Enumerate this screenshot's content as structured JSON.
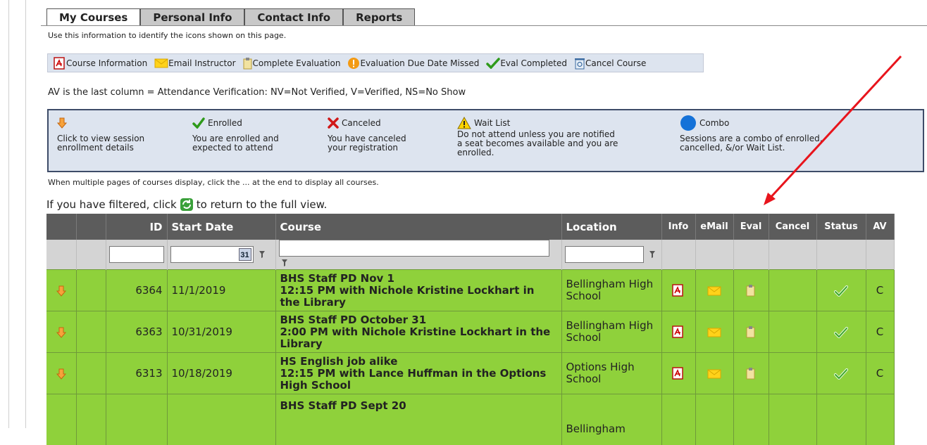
{
  "tabs": [
    {
      "label": "My Courses",
      "active": true
    },
    {
      "label": "Personal Info",
      "active": false
    },
    {
      "label": "Contact Info",
      "active": false
    },
    {
      "label": "Reports",
      "active": false
    }
  ],
  "icon_hint": "Use this information to identify the icons shown on this page.",
  "icon_legend": {
    "course_info": "Course Information",
    "email": "Email Instructor",
    "complete_eval": "Complete Evaluation",
    "due_missed": "Evaluation Due Date Missed",
    "eval_completed": "Eval Completed",
    "cancel": "Cancel Course"
  },
  "av_note": "AV is the last column = Attendance Verification: NV=Not Verified, V=Verified, NS=No Show",
  "status_legend": {
    "session_desc": "Click to view session enrollment details",
    "enrolled_title": "Enrolled",
    "enrolled_desc": "You are enrolled and expected to attend",
    "canceled_title": "Canceled",
    "canceled_desc": "You have canceled your registration",
    "waitlist_title": "Wait List",
    "waitlist_desc": "Do not attend unless you are notified a seat becomes available and you are enrolled.",
    "combo_title": "Combo",
    "combo_desc": "Sessions are a combo of enrolled, cancelled, &/or Wait List."
  },
  "multi_note": "When multiple pages of courses display, click the ... at the end to display all courses.",
  "filter_note": {
    "before": "If you have filtered, click",
    "after": "to return to the full view."
  },
  "columns": {
    "id": "ID",
    "start_date": "Start Date",
    "course": "Course",
    "location": "Location",
    "info": "Info",
    "email": "eMail",
    "eval": "Eval",
    "cancel": "Cancel",
    "status": "Status",
    "av": "AV"
  },
  "calendar_label": "31",
  "rows": [
    {
      "id": "6364",
      "date": "11/1/2019",
      "title": "BHS Staff PD Nov 1",
      "detail": "12:15 PM with Nichole Kristine Lockhart in the Library",
      "location": "Bellingham High School",
      "av": "C"
    },
    {
      "id": "6363",
      "date": "10/31/2019",
      "title": "BHS Staff PD October 31",
      "detail": "2:00 PM with Nichole Kristine Lockhart in the Library",
      "location": "Bellingham High School",
      "av": "C"
    },
    {
      "id": "6313",
      "date": "10/18/2019",
      "title": "HS English job alike",
      "detail": "12:15 PM with Lance Huffman in the Options High School",
      "location": "Options High School",
      "av": "C"
    },
    {
      "id": "",
      "date": "",
      "title": "BHS Staff PD Sept 20",
      "detail": "",
      "location": "Bellingham",
      "av": ""
    }
  ],
  "colors": {
    "row_green": "#8fd13b",
    "header_gray": "#5c5c5c",
    "legend_blue": "#dde4ef",
    "annotation_red": "#e8141c"
  }
}
